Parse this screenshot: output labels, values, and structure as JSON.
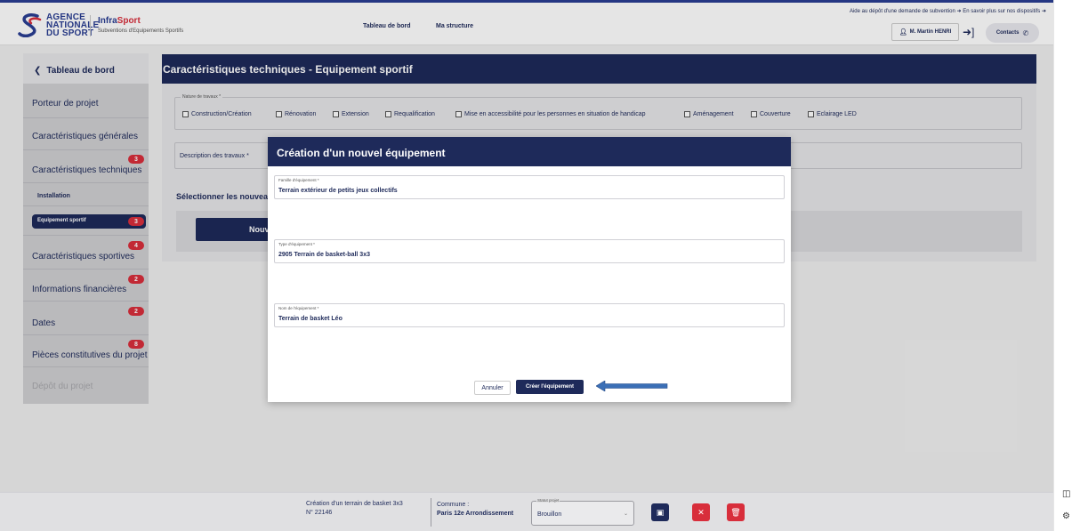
{
  "header": {
    "logo_line1": "AGENCE",
    "logo_line2": "NATIONALE",
    "logo_line3": "DU SPORT",
    "app_name_part1": "Infra",
    "app_name_part2": "Sport",
    "app_subtitle": "Subventions d'Equipements Sportifs",
    "nav": [
      "Tableau de bord",
      "Ma structure"
    ],
    "help_link": "Aide au dépôt d'une demande de subvention",
    "info_link": "En savoir plus sur nos dispositifs",
    "user_label": "M. Martin HENRI",
    "contacts_label": "Contacts"
  },
  "sidebar": {
    "back_label": "Tableau de bord",
    "items": [
      {
        "label": "Porteur de projet"
      },
      {
        "label": "Caractéristiques générales"
      },
      {
        "label": "Caractéristiques techniques",
        "badge": "3"
      },
      {
        "label": "Caractéristiques sportives",
        "badge": "4"
      },
      {
        "label": "Informations financières",
        "badge": "2"
      },
      {
        "label": "Dates",
        "badge": "2"
      },
      {
        "label": "Pièces constitutives du projet",
        "badge": "8"
      },
      {
        "label": "Dépôt du projet"
      }
    ],
    "sub_installation": "Installation",
    "sub_equipement": "Equipement sportif",
    "sub_equipement_badge": "3"
  },
  "main": {
    "title": "Caractéristiques techniques - Equipement sportif",
    "nature_legend": "Nature de travaux *",
    "nature_options": [
      "Construction/Création",
      "Rénovation",
      "Extension",
      "Requalification",
      "Mise en accessibilité pour les personnes en situation de handicap",
      "Aménagement",
      "Couverture",
      "Eclairage LED"
    ],
    "description_label": "Description des travaux *",
    "select_heading": "Sélectionner les nouveau",
    "new_button": "Nouv"
  },
  "modal": {
    "title": "Création d'un nouvel équipement",
    "famille_label": "Famille d'équipement *",
    "famille_value": "Terrain extérieur de petits jeux collectifs",
    "type_label": "Type d'équipement *",
    "type_value": "2905 Terrain de basket-ball 3x3",
    "nom_label": "Nom de l'équipement *",
    "nom_value": "Terrain de basket Léo",
    "cancel_label": "Annuler",
    "create_label": "Créer l'équipement"
  },
  "footer": {
    "project_name": "Création d'un terrain de basket 3x3",
    "project_number": "N° 22146",
    "commune_label": "Commune :",
    "commune_value": "Paris 12e Arrondissement",
    "status_label": "Statut projet",
    "status_value": "Brouillon"
  },
  "colors": {
    "primary": "#1e2a5a",
    "accent_red": "#d82e3b",
    "sidebar_bg": "#d0d0d2",
    "arrow": "#3b6fb6"
  },
  "icons": [
    "chevron-left-icon",
    "user-icon",
    "logout-icon",
    "phone-icon",
    "arrow-right-icon",
    "save-icon",
    "close-icon",
    "trash-icon",
    "chevron-down-icon",
    "sidebar-panel-icon",
    "settings-icon"
  ]
}
